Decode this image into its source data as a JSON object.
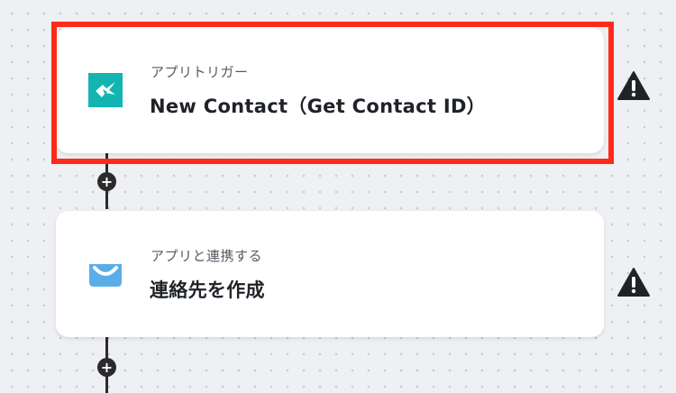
{
  "steps": [
    {
      "type_label": "アプリトリガー",
      "title": "New Contact（Get Contact ID）",
      "icon": "hubspot-style-teal-app-icon",
      "icon_color": "#12b5b0",
      "selected": true,
      "warning_icon": "warning-triangle-icon"
    },
    {
      "type_label": "アプリと連携する",
      "title": "連絡先を作成",
      "icon": "envelope-app-icon",
      "icon_color": "#5aaee8",
      "selected": false,
      "warning_icon": "warning-triangle-icon"
    }
  ],
  "add_step_icon": "plus-icon",
  "highlight_color": "#ff2a1a"
}
